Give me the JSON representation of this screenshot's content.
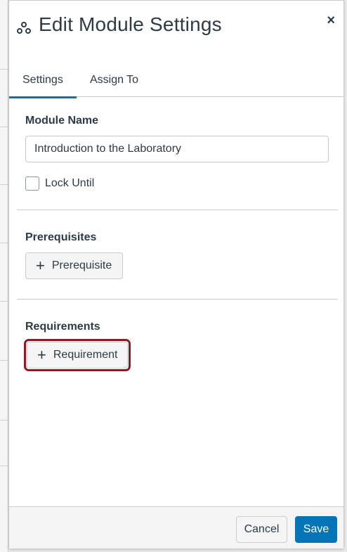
{
  "dialog": {
    "title": "Edit Module Settings",
    "close_label": "×",
    "header_icon": "modules-icon"
  },
  "tabs": [
    {
      "label": "Settings",
      "active": true
    },
    {
      "label": "Assign To",
      "active": false
    }
  ],
  "module_name": {
    "label": "Module Name",
    "value": "Introduction to the Laboratory"
  },
  "lock_until": {
    "label": "Lock Until",
    "checked": false
  },
  "prerequisites": {
    "label": "Prerequisites",
    "button_label": "Prerequisite"
  },
  "requirements": {
    "label": "Requirements",
    "button_label": "Requirement"
  },
  "footer": {
    "cancel_label": "Cancel",
    "save_label": "Save"
  },
  "colors": {
    "accent": "#0374b5",
    "highlight": "#8b1c22",
    "text": "#2d3b45"
  }
}
